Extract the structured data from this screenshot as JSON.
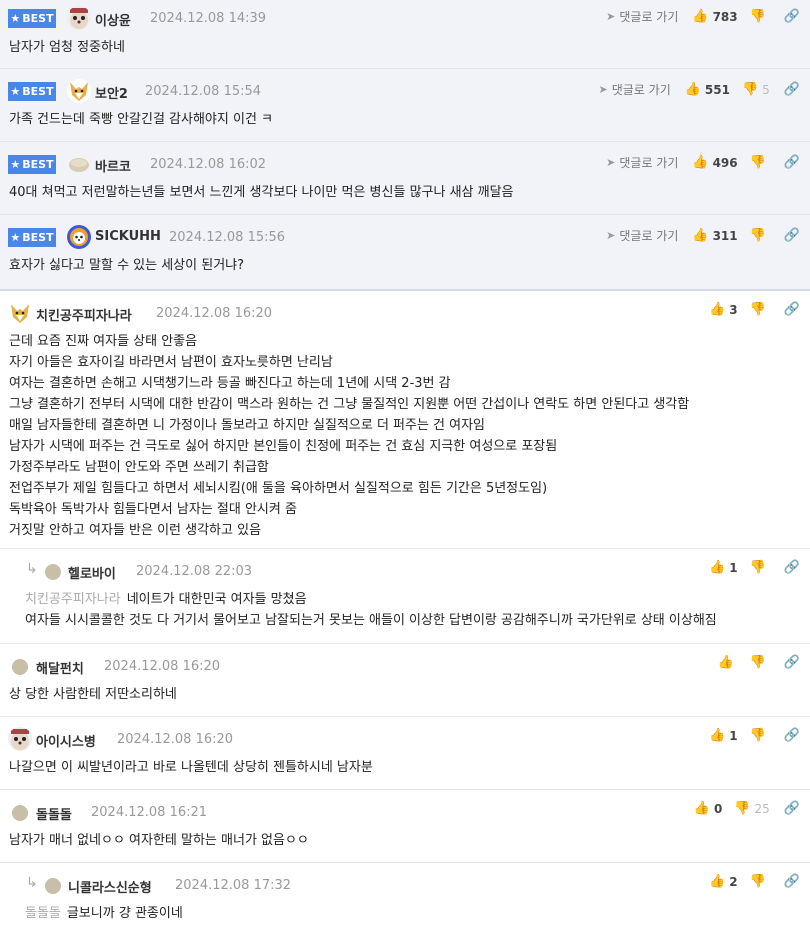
{
  "best_label": "BEST",
  "goto_label": "댓글로 가기",
  "comments": [
    {
      "nick": "이상윤",
      "date": "2024.12.08 14:39",
      "up": "783",
      "down": "",
      "text": "남자가 엄청 정중하네"
    },
    {
      "nick": "보안2",
      "date": "2024.12.08 15:54",
      "up": "551",
      "down": "5",
      "text": "가족 건드는데 죽빵 안갈긴걸 감사해야지 이건 ㅋ"
    },
    {
      "nick": "바르코",
      "date": "2024.12.08 16:02",
      "up": "496",
      "down": "",
      "text": "40대 쳐먹고 저런말하는년들 보면서 느낀게 생각보다 나이만 먹은 병신들 많구나 새삼 깨달음"
    },
    {
      "nick": "SICKUHH",
      "date": "2024.12.08 15:56",
      "up": "311",
      "down": "",
      "text": "효자가 싫다고 말할 수 있는 세상이 된거냐?"
    },
    {
      "nick": "치킨공주피자나라",
      "date": "2024.12.08 16:20",
      "up": "3",
      "down": "",
      "lines": [
        "근데 요즘 진짜 여자들 상태 안좋음",
        "자기 아들은 효자이길 바라면서 남편이 효자노릇하면 난리남",
        "여자는 결혼하면 손해고 시댁챙기느라 등골 빠진다고 하는데 1년에 시댁 2-3번 감",
        "그냥 결혼하기 전부터 시댁에 대한 반감이 맥스라 원하는 건 그냥 물질적인 지원뿐 어떤 간섭이나 연락도 하면 안된다고 생각함",
        "매일 남자들한테 결혼하면 니 가정이나 돌보라고 하지만 실질적으로 더 퍼주는 건 여자임",
        "남자가 시댁에 퍼주는 건 극도로 싫어 하지만 본인들이 친정에 퍼주는 건 효심 지극한 여성으로 포장됨",
        "가정주부라도 남편이 안도와 주면 쓰레기 취급함",
        "전업주부가 제일 힘들다고 하면서 세뇌시킴(애 둘을 육아하면서 실질적으로 힘든 기간은 5년정도임)",
        "독박육아 독박가사 힘들다면서 남자는 절대 안시켜 줌",
        "거짓말 안하고 여자들 반은 이런 생각하고 있음"
      ]
    },
    {
      "nick": "헬로바이",
      "date": "2024.12.08 22:03",
      "up": "1",
      "down": "",
      "quote": "치킨공주피자나라",
      "lines": [
        "네이트가 대한민국 여자들 망쳤음",
        "여자들 시시콜콜한 것도 다 거기서 물어보고 남잘되는거 못보는 애들이 이상한 답변이랑 공감해주니까 국가단위로 상태 이상해짐"
      ]
    },
    {
      "nick": "해달펀치",
      "date": "2024.12.08 16:20",
      "up": "",
      "down": "",
      "text": "상 당한 사람한테 저딴소리하네"
    },
    {
      "nick": "아이시스병",
      "date": "2024.12.08 16:20",
      "up": "1",
      "down": "",
      "text": "나갈으면 이 씨발년이라고 바로 나올텐데 상당히 젠틀하시네 남자분"
    },
    {
      "nick": "돌돌돌",
      "date": "2024.12.08 16:21",
      "up": "0",
      "down": "25",
      "text": "남자가 매너 없네ㅇㅇ 여자한테 말하는 매너가 없음ㅇㅇ"
    },
    {
      "nick": "니콜라스신순형",
      "date": "2024.12.08 17:32",
      "up": "2",
      "down": "",
      "quote": "돌돌돌",
      "text": "글보니까 걍 관종이네"
    }
  ]
}
